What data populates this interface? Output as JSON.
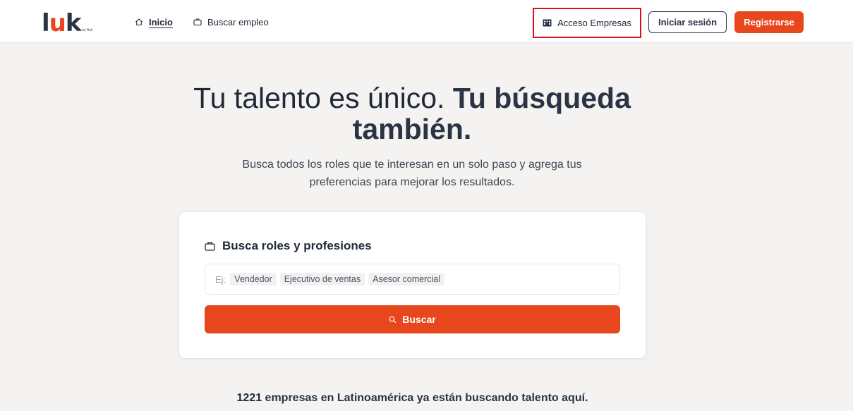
{
  "header": {
    "logo": {
      "text_a": "l",
      "text_u": "u",
      "text_b": "k",
      "sub": "by Buk"
    },
    "nav": [
      {
        "label": "Inicio",
        "icon": "home-icon"
      },
      {
        "label": "Buscar empleo",
        "icon": "briefcase-icon"
      }
    ],
    "access_label": "Acceso Empresas",
    "login_label": "Iniciar sesión",
    "register_label": "Registrarse"
  },
  "hero": {
    "title_regular": "Tu talento es único.",
    "title_bold_1": "Tu búsqueda",
    "title_bold_2": "también.",
    "subtitle": "Busca todos los roles que te interesan en un solo paso y agrega tus preferencias para mejorar los resultados."
  },
  "search": {
    "title": "Busca roles y profesiones",
    "prefix": "Ej:",
    "chips": [
      "Vendedor",
      "Ejecutivo de ventas",
      "Asesor comercial"
    ],
    "button_label": "Buscar"
  },
  "stat": {
    "number": "1221",
    "text": "empresas en Latinoamérica ya están buscando talento aquí."
  },
  "colors": {
    "accent": "#e8461c",
    "dark": "#2b3444",
    "highlight_border": "#d90f1c"
  }
}
